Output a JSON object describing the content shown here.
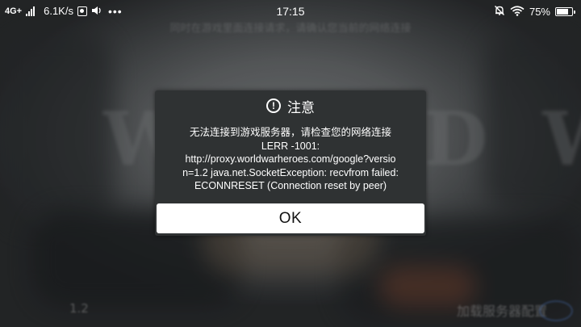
{
  "status_bar": {
    "network_type": "4G+",
    "speed": "6.1K/s",
    "time": "17:15",
    "battery_percent": "75%",
    "battery_level": 0.75,
    "icons": [
      "signal-icon",
      "notification-box-icon",
      "speaker-icon",
      "more-dots-icon",
      "alarm-off-icon",
      "wifi-icon",
      "battery-icon"
    ]
  },
  "background": {
    "top_text": "同时在游戏里面连接请求，请确认您当前的网络连接",
    "title_text": "WORLD WAR",
    "bottom_left_text": "1.2",
    "bottom_right_text": "加载服务器配置"
  },
  "dialog": {
    "icon": "alert-circle-icon",
    "title": "注意",
    "message_lines": [
      "无法连接到游戏服务器，请检查您的网络连接",
      "LERR -1001:",
      "http://proxy.worldwarheroes.com/google?versio",
      "n=1.2 java.net.SocketException: recvfrom failed:",
      "ECONNRESET (Connection reset by peer)"
    ],
    "ok_label": "OK"
  },
  "colors": {
    "dialog_bg": "#2f3233",
    "button_bg": "#ffffff",
    "text": "#ffffff"
  }
}
